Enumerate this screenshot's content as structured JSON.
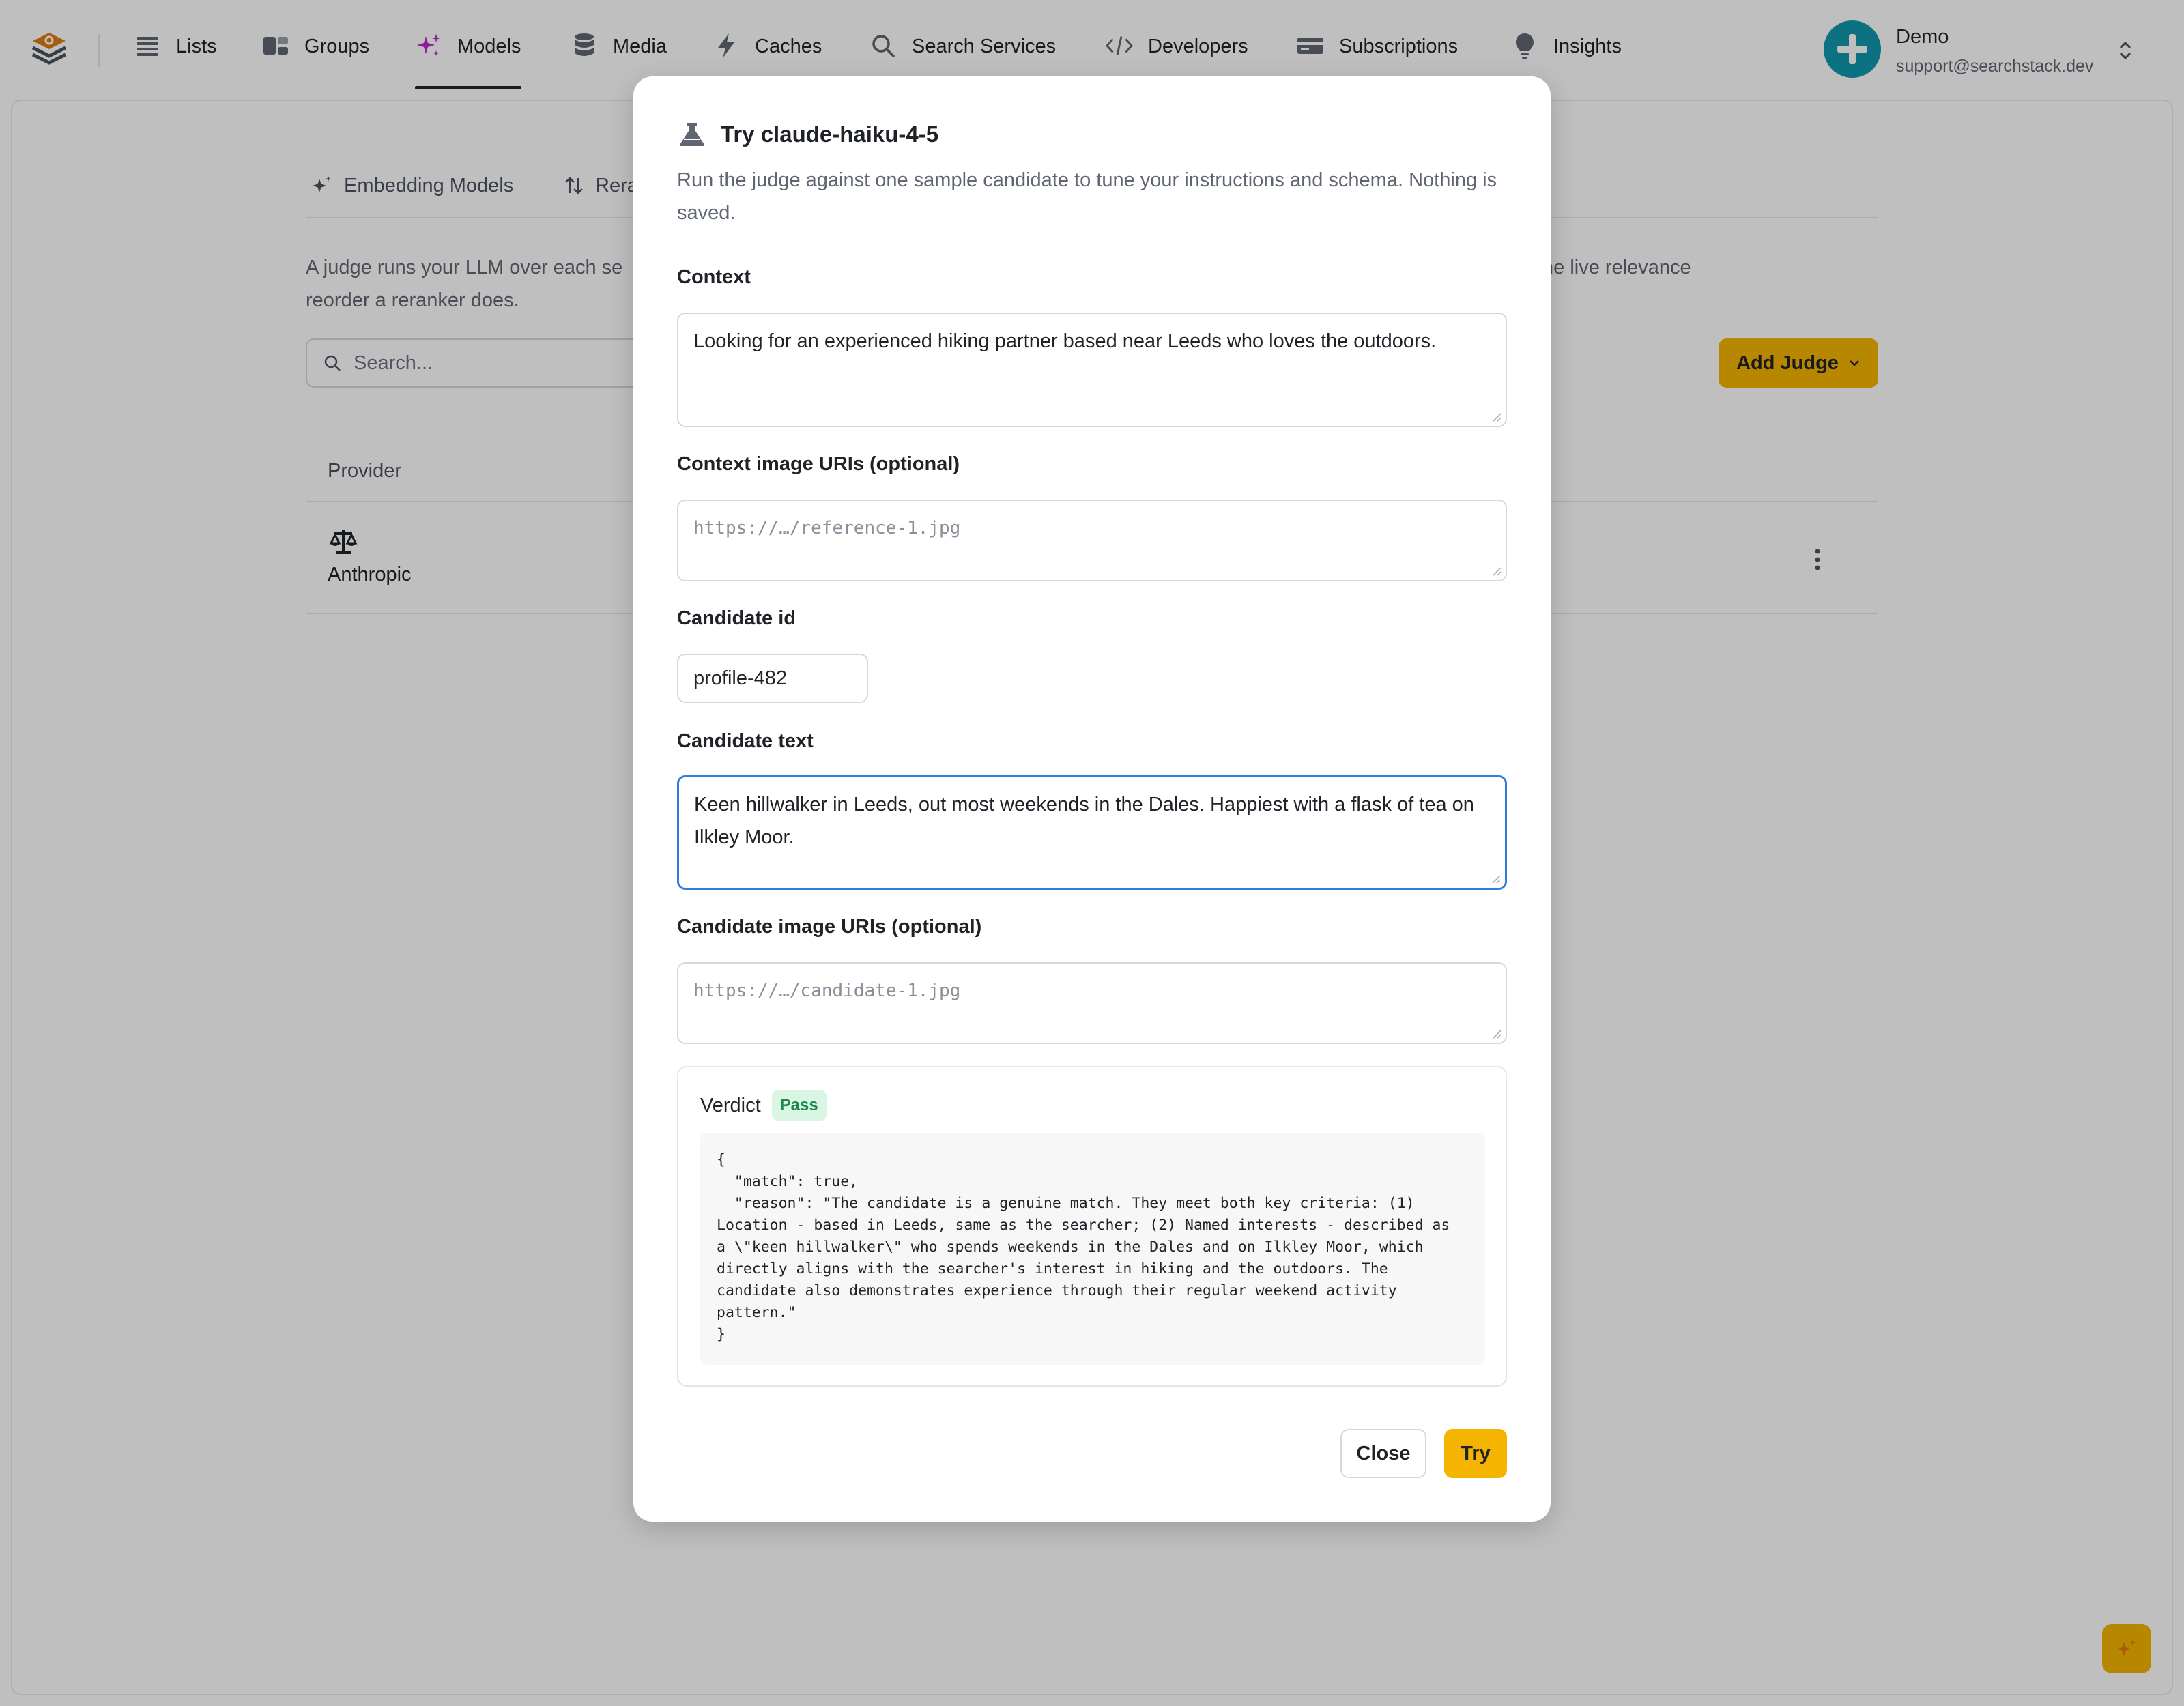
{
  "nav": {
    "items": [
      {
        "label": "Lists",
        "icon": "list-icon"
      },
      {
        "label": "Groups",
        "icon": "groups-icon"
      },
      {
        "label": "Models",
        "icon": "sparkles-icon",
        "active": true
      },
      {
        "label": "Media",
        "icon": "database-icon"
      },
      {
        "label": "Caches",
        "icon": "bolt-icon"
      },
      {
        "label": "Search Services",
        "icon": "search-icon"
      },
      {
        "label": "Developers",
        "icon": "code-icon"
      },
      {
        "label": "Subscriptions",
        "icon": "credit-card-icon"
      },
      {
        "label": "Insights",
        "icon": "lightbulb-icon"
      }
    ]
  },
  "account": {
    "name": "Demo",
    "email": "support@searchstack.dev"
  },
  "page": {
    "tabs": [
      {
        "label": "Embedding Models"
      },
      {
        "label": "Rera"
      }
    ],
    "description_left": "A judge runs your LLM over each se",
    "description_left_2": "reorder a reranker does.",
    "description_right": "he live relevance",
    "search_placeholder": "Search...",
    "add_judge_label": "Add Judge",
    "table": {
      "header_provider": "Provider",
      "rows": [
        {
          "provider": "Anthropic"
        }
      ]
    }
  },
  "modal": {
    "title": "Try claude-haiku-4-5",
    "subtitle": "Run the judge against one sample candidate to tune your instructions and schema. Nothing is saved.",
    "context_label": "Context",
    "context_value": "Looking for an experienced hiking partner based near Leeds who loves the outdoors.",
    "context_images_label": "Context image URIs (optional)",
    "context_images_placeholder": "https://…/reference-1.jpg",
    "candidate_id_label": "Candidate id",
    "candidate_id_value": "profile-482",
    "candidate_text_label": "Candidate text",
    "candidate_text_value": "Keen hillwalker in Leeds, out most weekends in the Dales. Happiest with a flask of tea on Ilkley Moor.",
    "candidate_images_label": "Candidate image URIs (optional)",
    "candidate_images_placeholder": "https://…/candidate-1.jpg",
    "verdict_label": "Verdict",
    "verdict_badge": "Pass",
    "verdict_json": "{\n  \"match\": true,\n  \"reason\": \"The candidate is a genuine match. They meet both key criteria: (1)\nLocation - based in Leeds, same as the searcher; (2) Named interests - described as\na \\\"keen hillwalker\\\" who spends weekends in the Dales and on Ilkley Moor, which\ndirectly aligns with the searcher's interest in hiking and the outdoors. The\ncandidate also demonstrates experience through their regular weekend activity\npattern.\"\n}",
    "close_label": "Close",
    "try_label": "Try"
  },
  "colors": {
    "accent": "#f5b400",
    "focus": "#2f7de1",
    "pass_bg": "#d9f5e3",
    "pass_fg": "#1d8a4a",
    "avatar": "#1098ad"
  }
}
